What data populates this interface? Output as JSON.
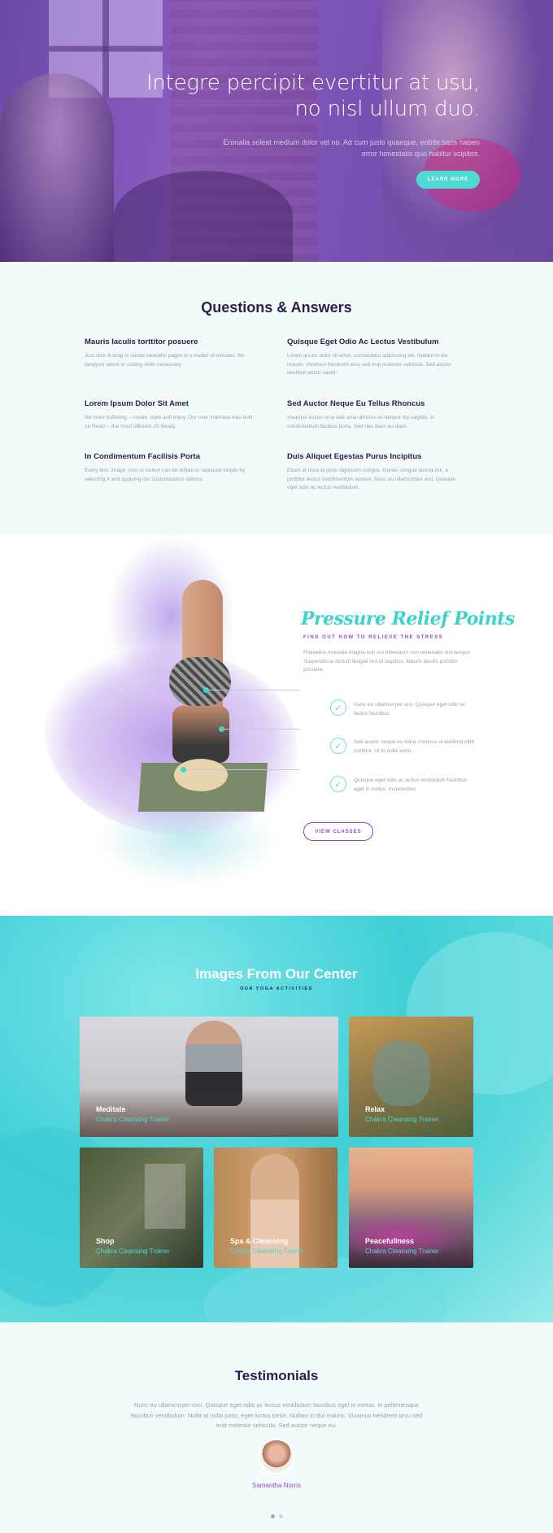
{
  "hero": {
    "title_line1": "Integre percipit evertitur at usu,",
    "title_line2": "no nisl ullum duo.",
    "subtitle": "Eronalia soleat medium dolor vel no. Ad cum justo quaeque, eobite sans habeo error honestatis quo habitur scipitos.",
    "button_label": "LEARN MORE",
    "accent": "#4dd9d4"
  },
  "qa": {
    "title": "Questions & Answers",
    "items": [
      {
        "q": "Mauris Iaculis torttitor posuere",
        "a": "Just click & drag to create beautiful pages in a matter of minutes. No designer talent or coding skills necessary."
      },
      {
        "q": "Quisque Eget Odio Ac Lectus Vestibulum",
        "a": "Lorem ipsum dolor sit amet, consectetur adipiscing elit. Nullam in dui mauris. Vivamus hendrerit arcu sed erat molestie vehicula. Sed auctor desrbuh eldotr saetd."
      },
      {
        "q": "Lorem Ipsum Dolor Sit Amet",
        "a": "No more buffering – create, style and enjoy. Our user interface was built on React – the most efficient JS library."
      },
      {
        "q": "Sed Auctor Neque Eu Tellus Rhoncus",
        "a": "Vivamus luctus urna sed urna ultricies ac tempor dui sagittis. In condimentum facilisis porta. Sed nec diam eu diam."
      },
      {
        "q": "In Condimentum Facilisis Porta",
        "a": "Every text, image, icon or button can be edited or replaced simply by selecting it and applying our customisation options."
      },
      {
        "q": "Duis Aliquet Egestas Purus Incipitus",
        "a": "Etiam at risus et justo dignissim congue. Donec congue lacinia dui, a porttitor lectus condimentum laoreet. Nunc eu ullamcorper orci. Quisque eget odio ac lectus vestibulum."
      }
    ]
  },
  "pressure": {
    "title": "Pressure Relief Points",
    "subtitle": "FIND OUT HOW TO RELIEVE THE STRESS",
    "body": "Phasellus molestie magna non est bibendum non venenatis nisl tempor. Suspendisse dictum feugiat nisl ut dapibus. Mauris iaculis porttitor posuere.",
    "points": [
      "Nunc eu ullamcorper orci. Quisque eget odio ac lectus faucibus.",
      "Sed auctor neque eu tellus rhoncus ut eleifend nibh porttitor. Ut in nulla enim.",
      "Quisque eget odio ac lectus vestibulum faucibus eget in metus. In pellentes."
    ],
    "button_label": "VIEW CLASSES",
    "title_color": "#3ed2cb",
    "subtitle_color": "#9b3fcf"
  },
  "gallery": {
    "title": "Images From Our Center",
    "subtitle": "OUR YOGA ACTIVITIES",
    "tiles": [
      {
        "label": "Meditate",
        "sub": "Chakra Cleansing Trainer"
      },
      {
        "label": "Relax",
        "sub": "Chakra Cleansing Trainer"
      },
      {
        "label": "Shop",
        "sub": "Chakra Cleansing Trainer"
      },
      {
        "label": "Spa & Cleansing",
        "sub": "Chakra Cleansing Trainer"
      },
      {
        "label": "Peacefullness",
        "sub": "Chakra Cleansing Trainer"
      }
    ]
  },
  "testimonials": {
    "title": "Testimonials",
    "quote": "Nunc eu ullamcorper orci. Quisque eget odio ac lectus vestibulum faucibus eget in metus. In pellentesque faucibus vestibulum. Nulla at nulla justo, eget luctus tortor. Nullam in dui mauris. Vivamus hendrerit arcu sed erat molestie vehicula. Sed auctor neque eu.",
    "name": "Samantha Norris"
  }
}
